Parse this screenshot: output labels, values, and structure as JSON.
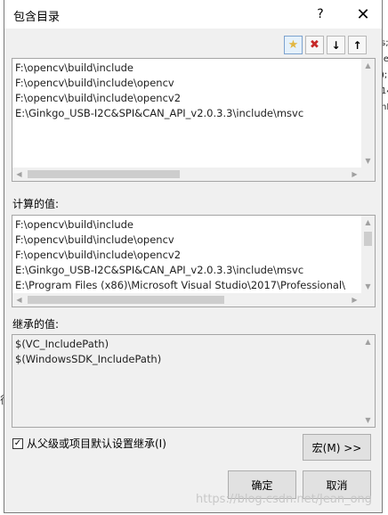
{
  "background": {
    "right_fragment": "s;S\nle:\n);\n14\nnP",
    "left_fragment": "径"
  },
  "dialog": {
    "title": "包含目录",
    "help_label": "?",
    "close_label": "✕"
  },
  "toolbar": {
    "icons": [
      "new-folder-icon",
      "delete-icon",
      "move-down-icon",
      "move-up-icon"
    ],
    "glyphs": {
      "new": "★",
      "delete": "✖",
      "down": "↓",
      "up": "↑"
    }
  },
  "colors": {
    "delete": "#c62828",
    "new_folder": "#e2b640",
    "selection_border": "#7da2ce"
  },
  "edit_list": {
    "lines": [
      "F:\\opencv\\build\\include",
      "F:\\opencv\\build\\include\\opencv",
      "F:\\opencv\\build\\include\\opencv2",
      "E:\\Ginkgo_USB-I2C&SPI&CAN_API_v2.0.3.3\\include\\msvc"
    ]
  },
  "evaluated": {
    "label": "计算的值:",
    "lines": [
      "F:\\opencv\\build\\include",
      "F:\\opencv\\build\\include\\opencv",
      "F:\\opencv\\build\\include\\opencv2",
      "E:\\Ginkgo_USB-I2C&SPI&CAN_API_v2.0.3.3\\include\\msvc",
      "E:\\Program Files (x86)\\Microsoft Visual Studio\\2017\\Professional\\"
    ]
  },
  "inherited": {
    "label": "继承的值:",
    "lines": [
      "$(VC_IncludePath)",
      "$(WindowsSDK_IncludePath)"
    ]
  },
  "inherit_checkbox": {
    "label": "从父级或项目默认设置继承(I)",
    "checked": true,
    "check_glyph": "✓"
  },
  "buttons": {
    "macros": "宏(M) >>",
    "ok": "确定",
    "cancel": "取消"
  },
  "scroll_arrows": {
    "up": "▲",
    "down": "▼",
    "left": "◀",
    "right": "▶"
  },
  "watermark": "https://blog.csdn.net/Jean_ong"
}
